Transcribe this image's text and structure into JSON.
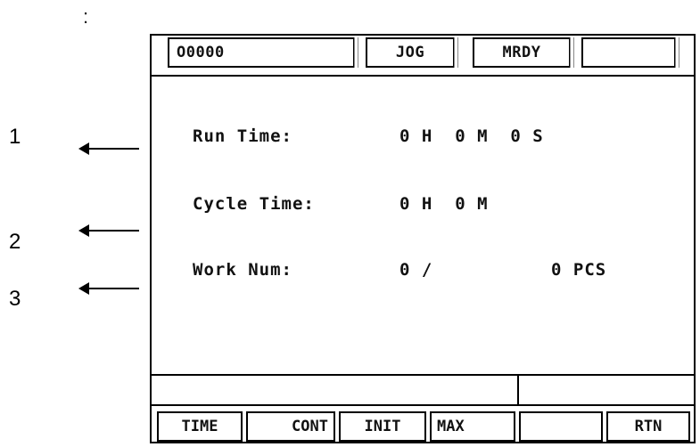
{
  "annotation": {
    "colon": ":",
    "callouts": [
      "1",
      "2",
      "3"
    ]
  },
  "header": {
    "program": "O0000",
    "mode": "JOG",
    "status": "MRDY",
    "extra": ""
  },
  "rows": [
    {
      "label": "Run Time:",
      "value": "0 H  0 M  0 S"
    },
    {
      "label": "Cycle Time:",
      "value": "0 H  0 M"
    },
    {
      "label": "Work Num:",
      "value": "0 /",
      "value2": "0 PCS"
    }
  ],
  "status_bar": {
    "left": "",
    "right": ""
  },
  "softkeys": [
    "TIME",
    "CONT",
    "INIT",
    "MAX",
    "",
    "RTN"
  ],
  "colors": {
    "border": "#000000",
    "background": "#ffffff",
    "text": "#111111"
  }
}
